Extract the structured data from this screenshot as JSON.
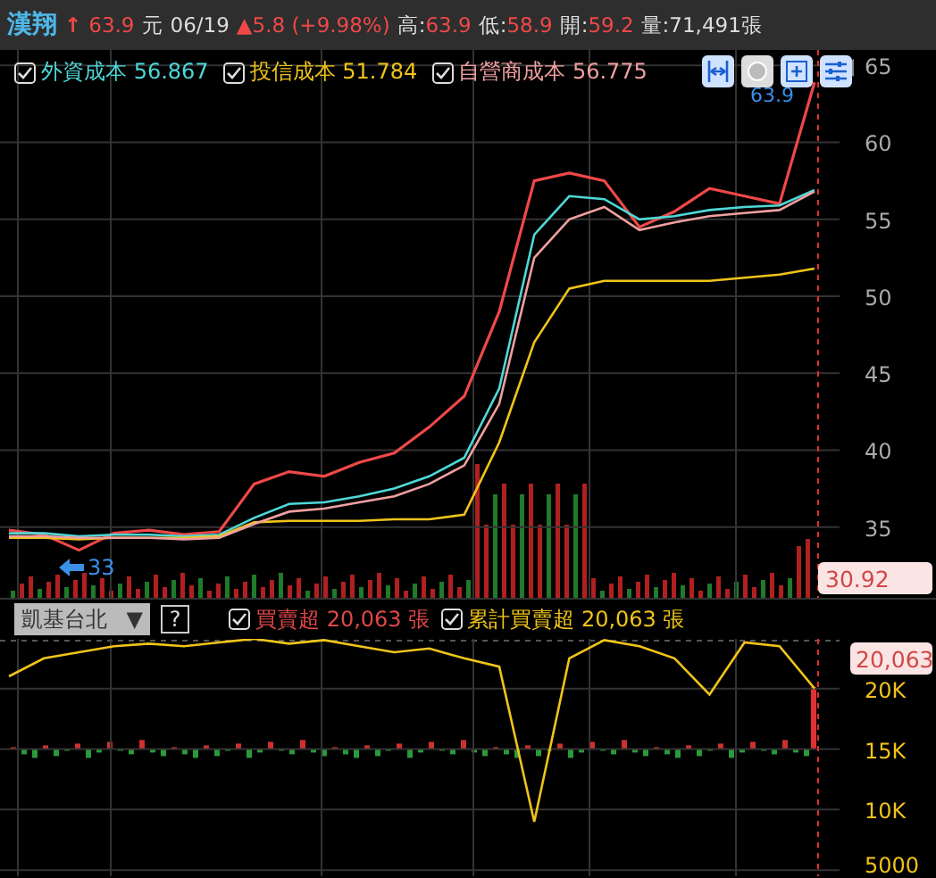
{
  "header": {
    "name": "漢翔",
    "arrow": "↑",
    "price": "63.9",
    "unit": "元",
    "date": "06/19",
    "change": "▲5.8 (+9.98%)",
    "stats": [
      {
        "label": "高:",
        "value": "63.9"
      },
      {
        "label": "低:",
        "value": "58.9"
      },
      {
        "label": "開:",
        "value": "59.2"
      }
    ],
    "volume": "量:71,491張"
  },
  "legend": [
    {
      "value": "56.867",
      "checked": true
    },
    {
      "value": "51.784",
      "checked": true
    },
    {
      "value": "56.775",
      "checked": true
    }
  ],
  "high_marker": "63.9",
  "low_marker": "33",
  "volume_tag": "30.92",
  "chart_data": {
    "type": "line",
    "grid": true,
    "ylim": [
      30.4,
      66
    ],
    "yticks": [
      35,
      40,
      45,
      50,
      55,
      60,
      65
    ],
    "series": [
      {
        "color": "#f04848",
        "values": [
          34.8,
          34.5,
          33.5,
          34.6,
          34.8,
          34.5,
          34.7,
          37.8,
          38.6,
          38.3,
          39.2,
          39.8,
          41.5,
          43.5,
          49,
          57.5,
          58,
          57.5,
          54.5,
          55.5,
          57,
          56.5,
          56,
          63.9
        ]
      },
      {
        "name": "外資成本",
        "color": "#4fd8d8",
        "values": [
          34.6,
          34.6,
          34.4,
          34.5,
          34.5,
          34.4,
          34.5,
          35.6,
          36.5,
          36.6,
          37,
          37.5,
          38.3,
          39.5,
          44,
          54,
          56.5,
          56.3,
          55,
          55.2,
          55.6,
          55.8,
          55.9,
          56.9
        ]
      },
      {
        "name": "投信成本",
        "color": "#f0c419",
        "values": [
          34.3,
          34.3,
          34.2,
          34.3,
          34.3,
          34.3,
          34.4,
          35.3,
          35.4,
          35.4,
          35.4,
          35.5,
          35.5,
          35.8,
          40.5,
          47,
          50.5,
          51,
          51,
          51,
          51,
          51.2,
          51.4,
          51.8
        ]
      },
      {
        "name": "自營商成本",
        "color": "#f0a0a0",
        "values": [
          34.4,
          34.4,
          34.3,
          34.3,
          34.3,
          34.2,
          34.3,
          35.2,
          36,
          36.2,
          36.6,
          37,
          37.8,
          39,
          43,
          52.5,
          55,
          55.8,
          54.3,
          54.8,
          55.2,
          55.4,
          55.6,
          56.8
        ]
      }
    ]
  },
  "lower": {
    "dropdown": {
      "value": "凱基台北",
      "caret": "▼"
    },
    "help": "?",
    "legend": [
      {
        "label": "買賣超",
        "value": "20,063 張",
        "checked": true,
        "color": "#e04848"
      },
      {
        "value": "20,063 張",
        "checked": true
      }
    ],
    "tag": "20,063",
    "chart_data": {
      "type": "line",
      "grid": true,
      "ylim": [
        4500,
        24100
      ],
      "yticks": [
        {
          "value": 20000,
          "label": "20K"
        },
        {
          "value": 15000,
          "label": "15K"
        },
        {
          "value": 10000,
          "label": "10K"
        },
        {
          "value": 5000,
          "label": "5000"
        }
      ],
      "series": [
        {
          "name": "累計買賣超",
          "color": "#f0c419",
          "values": [
            21000,
            22500,
            23000,
            23500,
            23700,
            23500,
            23800,
            24100,
            23700,
            24000,
            23500,
            23000,
            23300,
            22500,
            21800,
            9000,
            22500,
            24000,
            23500,
            22500,
            19500,
            23800,
            23500,
            20000
          ]
        }
      ]
    }
  }
}
